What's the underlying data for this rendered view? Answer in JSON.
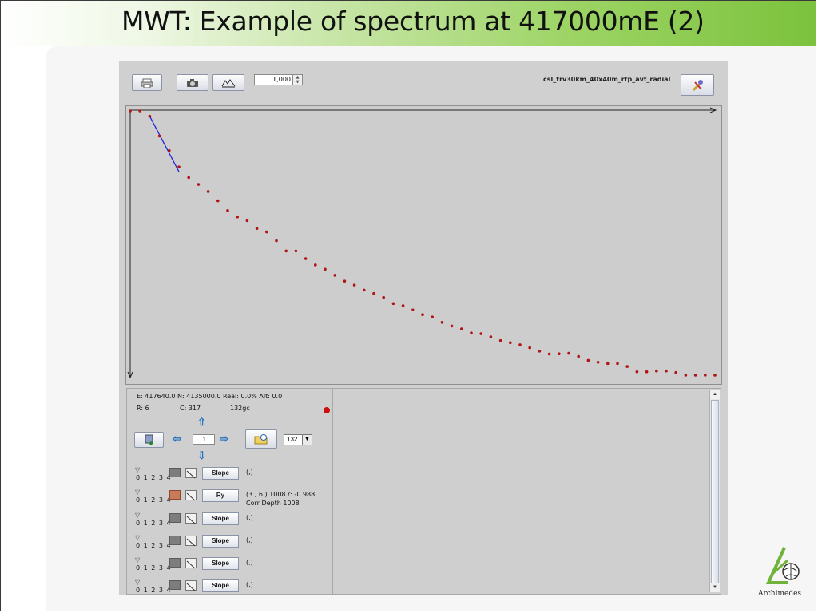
{
  "slide": {
    "title": "MWT: Example of spectrum at 417000mE (2)"
  },
  "toolbar": {
    "zoom_value": "1,000",
    "dataset": "csl_trv30km_40x40m_rtp_avf_radial",
    "icons": [
      "printer-icon",
      "camera-icon",
      "profile-icon",
      "tools-icon"
    ]
  },
  "info": {
    "coords": "E: 417640.0  N: 4135000.0  Real: 0.0%  Alt: 0.0",
    "r_label": "R: 6",
    "c_label": "C: 317",
    "gc_label": "132gc",
    "step_value": "1",
    "select_value": "132"
  },
  "rows": [
    {
      "digits": "0 1 2 3 4",
      "button": "Slope",
      "value": "(,)",
      "value2": "",
      "eye_active": false
    },
    {
      "digits": "0 1 2 3 4",
      "button": "Ry",
      "value": "(3 , 6 )  1008    r: -0.988",
      "value2": "Corr      Depth  1008",
      "eye_active": true
    },
    {
      "digits": "0 1 2 3 4",
      "button": "Slope",
      "value": "(,)",
      "value2": "",
      "eye_active": false
    },
    {
      "digits": "0 1 2 3 4",
      "button": "Slope",
      "value": "(,)",
      "value2": "",
      "eye_active": false
    },
    {
      "digits": "0 1 2 3 4",
      "button": "Slope",
      "value": "(,)",
      "value2": "",
      "eye_active": false
    },
    {
      "digits": "0 1 2 3 4",
      "button": "Slope",
      "value": "(,)",
      "value2": "",
      "eye_active": false
    }
  ],
  "colors": {
    "points": "#b01414",
    "fit_line": "#1e1ee0",
    "status_dot": "#cc1010",
    "accent": "#7cc23d"
  },
  "chart_data": {
    "type": "scatter",
    "title": "",
    "xlabel": "",
    "ylabel": "",
    "x": [
      1,
      2,
      3,
      4,
      5,
      6,
      7,
      8,
      9,
      10,
      11,
      12,
      13,
      14,
      15,
      16,
      17,
      18,
      19,
      20,
      21,
      22,
      23,
      24,
      25,
      26,
      27,
      28,
      29,
      30,
      31,
      32,
      33,
      34,
      35,
      36,
      37,
      38,
      39,
      40,
      41,
      42,
      43,
      44,
      45,
      46,
      47,
      48,
      49,
      50,
      51,
      52,
      53,
      54,
      55,
      56,
      57,
      58,
      59,
      60,
      61
    ],
    "values": [
      1.0,
      1.0,
      0.98,
      0.905,
      0.85,
      0.788,
      0.748,
      0.722,
      0.695,
      0.66,
      0.623,
      0.599,
      0.585,
      0.555,
      0.542,
      0.509,
      0.47,
      0.47,
      0.441,
      0.417,
      0.401,
      0.378,
      0.356,
      0.341,
      0.322,
      0.309,
      0.294,
      0.271,
      0.263,
      0.247,
      0.229,
      0.22,
      0.2,
      0.186,
      0.175,
      0.16,
      0.157,
      0.145,
      0.131,
      0.123,
      0.115,
      0.104,
      0.091,
      0.08,
      0.081,
      0.083,
      0.071,
      0.056,
      0.049,
      0.044,
      0.044,
      0.033,
      0.013,
      0.013,
      0.016,
      0.016,
      0.01,
      0.0,
      0.0,
      0.0,
      0.0
    ],
    "fit_line": {
      "x": [
        3,
        6
      ],
      "y": [
        0.98,
        0.77
      ]
    },
    "ylim": [
      0,
      1
    ],
    "grid": false,
    "legend": "none"
  }
}
